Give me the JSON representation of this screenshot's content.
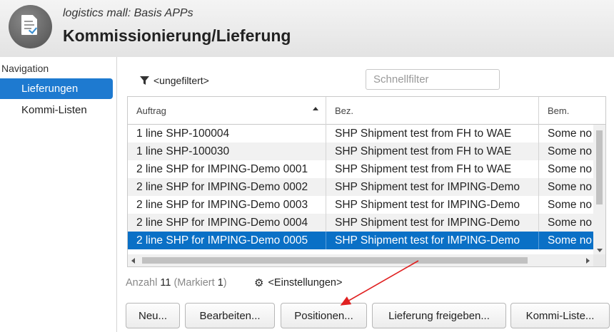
{
  "header": {
    "subtitle": "logistics mall: Basis APPs",
    "title": "Kommissionierung/Lieferung",
    "icon": "document-check-icon"
  },
  "nav": {
    "heading": "Navigation",
    "items": [
      {
        "label": "Lieferungen",
        "active": true
      },
      {
        "label": "Kommi-Listen",
        "active": false
      }
    ]
  },
  "filter": {
    "label": "<ungefiltert>",
    "icon": "funnel-icon",
    "quick_placeholder": "Schnellfilter"
  },
  "table": {
    "columns": [
      {
        "label": "Auftrag",
        "sorted": "asc"
      },
      {
        "label": "Bez."
      },
      {
        "label": "Bem."
      }
    ],
    "rows": [
      {
        "auftrag": "1 line SHP-100004",
        "bez": "SHP Shipment test from FH to WAE",
        "bem": "Some no",
        "selected": false
      },
      {
        "auftrag": "1 line SHP-100030",
        "bez": "SHP Shipment test from FH to WAE",
        "bem": "Some no",
        "selected": false
      },
      {
        "auftrag": "2 line SHP for IMPING-Demo 0001",
        "bez": "SHP Shipment test from FH to WAE",
        "bem": "Some no",
        "selected": false
      },
      {
        "auftrag": "2 line SHP for IMPING-Demo 0002",
        "bez": "SHP Shipment test for IMPING-Demo",
        "bem": "Some no",
        "selected": false
      },
      {
        "auftrag": "2 line SHP for IMPING-Demo 0003",
        "bez": "SHP Shipment test for IMPING-Demo",
        "bem": "Some no",
        "selected": false
      },
      {
        "auftrag": "2 line SHP for IMPING-Demo 0004",
        "bez": "SHP Shipment test for IMPING-Demo",
        "bem": "Some no",
        "selected": false
      },
      {
        "auftrag": "2 line SHP for IMPING-Demo 0005",
        "bez": "SHP Shipment test for IMPING-Demo",
        "bem": "Some no",
        "selected": true
      }
    ]
  },
  "status": {
    "count_label": "Anzahl",
    "count": "11",
    "marked_open": "(Markiert",
    "marked": "1",
    "marked_close": ")",
    "settings_label": "<Einstellungen>",
    "settings_icon": "gear-icon"
  },
  "buttons": {
    "new": "Neu...",
    "edit": "Bearbeiten...",
    "positions": "Positionen...",
    "release": "Lieferung freigeben...",
    "kommi": "Kommi-Liste..."
  },
  "colors": {
    "selection": "#0a70c6",
    "nav_active": "#1e7ad0",
    "annotation_arrow": "#e02020"
  }
}
